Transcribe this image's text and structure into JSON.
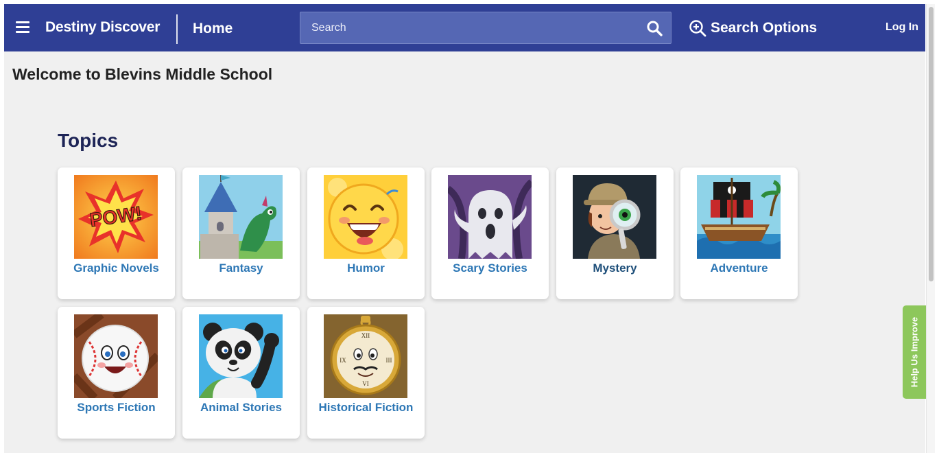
{
  "header": {
    "brand": "Destiny Discover",
    "home_label": "Home",
    "search_placeholder": "Search",
    "search_options_label": "Search Options",
    "login_label": "Log In"
  },
  "page": {
    "welcome": "Welcome to Blevins Middle School",
    "topics_title": "Topics"
  },
  "topics": [
    {
      "label": "Graphic Novels",
      "icon": "pow-comic-icon"
    },
    {
      "label": "Fantasy",
      "icon": "castle-dragon-icon"
    },
    {
      "label": "Humor",
      "icon": "laughing-emoji-icon"
    },
    {
      "label": "Scary Stories",
      "icon": "ghost-icon"
    },
    {
      "label": "Mystery",
      "icon": "detective-magnifier-icon"
    },
    {
      "label": "Adventure",
      "icon": "pirate-ship-icon"
    },
    {
      "label": "Sports Fiction",
      "icon": "baseball-face-icon"
    },
    {
      "label": "Animal Stories",
      "icon": "panda-icon"
    },
    {
      "label": "Historical Fiction",
      "icon": "pocket-watch-icon"
    }
  ],
  "feedback": {
    "label": "Help Us Improve"
  },
  "colors": {
    "header_bg": "#2f3f95",
    "search_bg": "#5567b4",
    "topic_label": "#2d77b5",
    "feedback_tab": "#8dc75b"
  }
}
